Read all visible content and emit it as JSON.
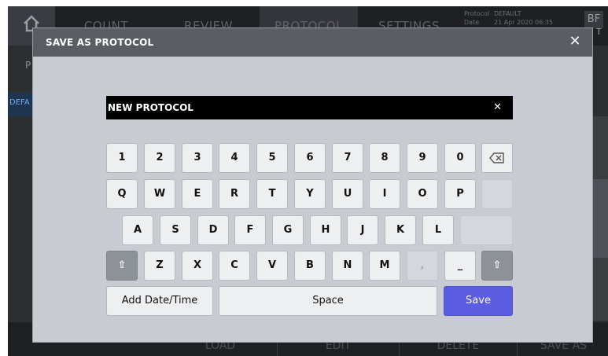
{
  "background": {
    "tabs": [
      "COUNT",
      "REVIEW",
      "PROTOCOL",
      "SETTINGS"
    ],
    "protocol_info": {
      "protocol_label": "Protocol",
      "protocol_value": "DEFAULT",
      "date_label": "Date",
      "date_value": "21 Apr 2020 06:35"
    },
    "badge": "BF",
    "badge_sub": "T",
    "left_letter": "P",
    "left_item": "DEFA",
    "bottom_actions": [
      "LOAD",
      "EDIT",
      "DELETE",
      "SAVE AS"
    ]
  },
  "modal": {
    "title": "SAVE AS PROTOCOL",
    "close_label": "✕",
    "name_value": "NEW PROTOCOL",
    "clear_label": "✕"
  },
  "keyboard": {
    "row1": [
      "1",
      "2",
      "3",
      "4",
      "5",
      "6",
      "7",
      "8",
      "9",
      "0"
    ],
    "row2": [
      "Q",
      "W",
      "E",
      "R",
      "T",
      "Y",
      "U",
      "I",
      "O",
      "P"
    ],
    "row3": [
      "A",
      "S",
      "D",
      "F",
      "G",
      "H",
      "J",
      "K",
      "L"
    ],
    "row4": [
      "Z",
      "X",
      "C",
      "V",
      "B",
      "N",
      "M",
      ",",
      "_"
    ],
    "shift_label": "⇧",
    "backspace_label": "⌫",
    "add_datetime_label": "Add Date/Time",
    "space_label": "Space",
    "save_label": "Save"
  },
  "colors": {
    "save_accent": "#5b5de0",
    "header_bg": "#5a5d64",
    "modal_bg": "#c8ccd2"
  }
}
